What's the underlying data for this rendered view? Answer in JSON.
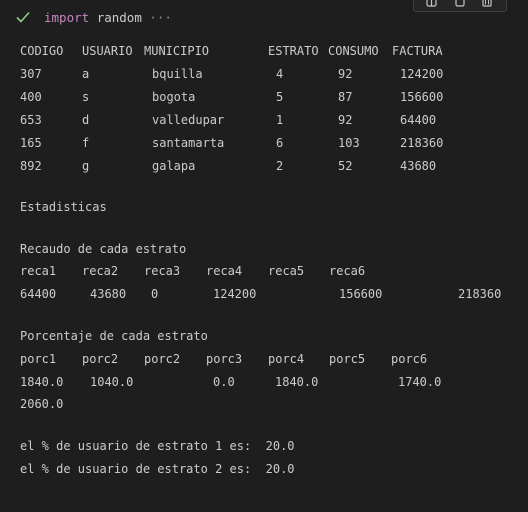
{
  "cell": {
    "status_icon": "check-icon",
    "code_keyword": "import",
    "code_module": "random",
    "ellipsis": "···"
  },
  "toolbar": {
    "icons": [
      "split-cell-icon",
      "copy-icon",
      "delete-icon"
    ]
  },
  "table": {
    "headers": [
      "CODIGO",
      "USUARIO",
      "MUNICIPIO",
      "ESTRATO",
      "CONSUMO",
      "FACTURA"
    ],
    "rows": [
      [
        "307",
        "a",
        "bquilla",
        "4",
        "92",
        "124200"
      ],
      [
        "400",
        "s",
        "bogota",
        "5",
        "87",
        "156600"
      ],
      [
        "653",
        "d",
        "valledupar",
        "1",
        "92",
        "64400"
      ],
      [
        "165",
        "f",
        "santamarta",
        "6",
        "103",
        "218360"
      ],
      [
        "892",
        "g",
        "galapa",
        "2",
        "52",
        "43680"
      ]
    ]
  },
  "stats": {
    "title": "Estadisticas",
    "recaudo_title": "Recaudo de cada estrato",
    "recaudo_headers": [
      "reca1",
      "reca2",
      "reca3",
      "reca4",
      "reca5",
      "reca6"
    ],
    "recaudo_values": [
      "64400",
      "43680",
      "0",
      "124200",
      "156600",
      "218360"
    ],
    "porcentaje_title": "Porcentaje de cada estrato",
    "porcentaje_headers": [
      "porc1",
      "porc2",
      "porc2",
      "porc3",
      "porc4",
      "porc5",
      "porc6"
    ],
    "porcentaje_values": [
      "1840.0",
      "1040.0",
      "0.0",
      "1840.0",
      "1740.0"
    ],
    "porcentaje_wrap": "2060.0",
    "usuario_lines": [
      "el % de usuario de estrato 1 es:  20.0",
      "el % de usuario de estrato 2 es:  20.0"
    ]
  },
  "colors": {
    "background": "#1e1e1e",
    "text": "#cccccc",
    "check": "#89d185",
    "keyword": "#c586c0"
  }
}
